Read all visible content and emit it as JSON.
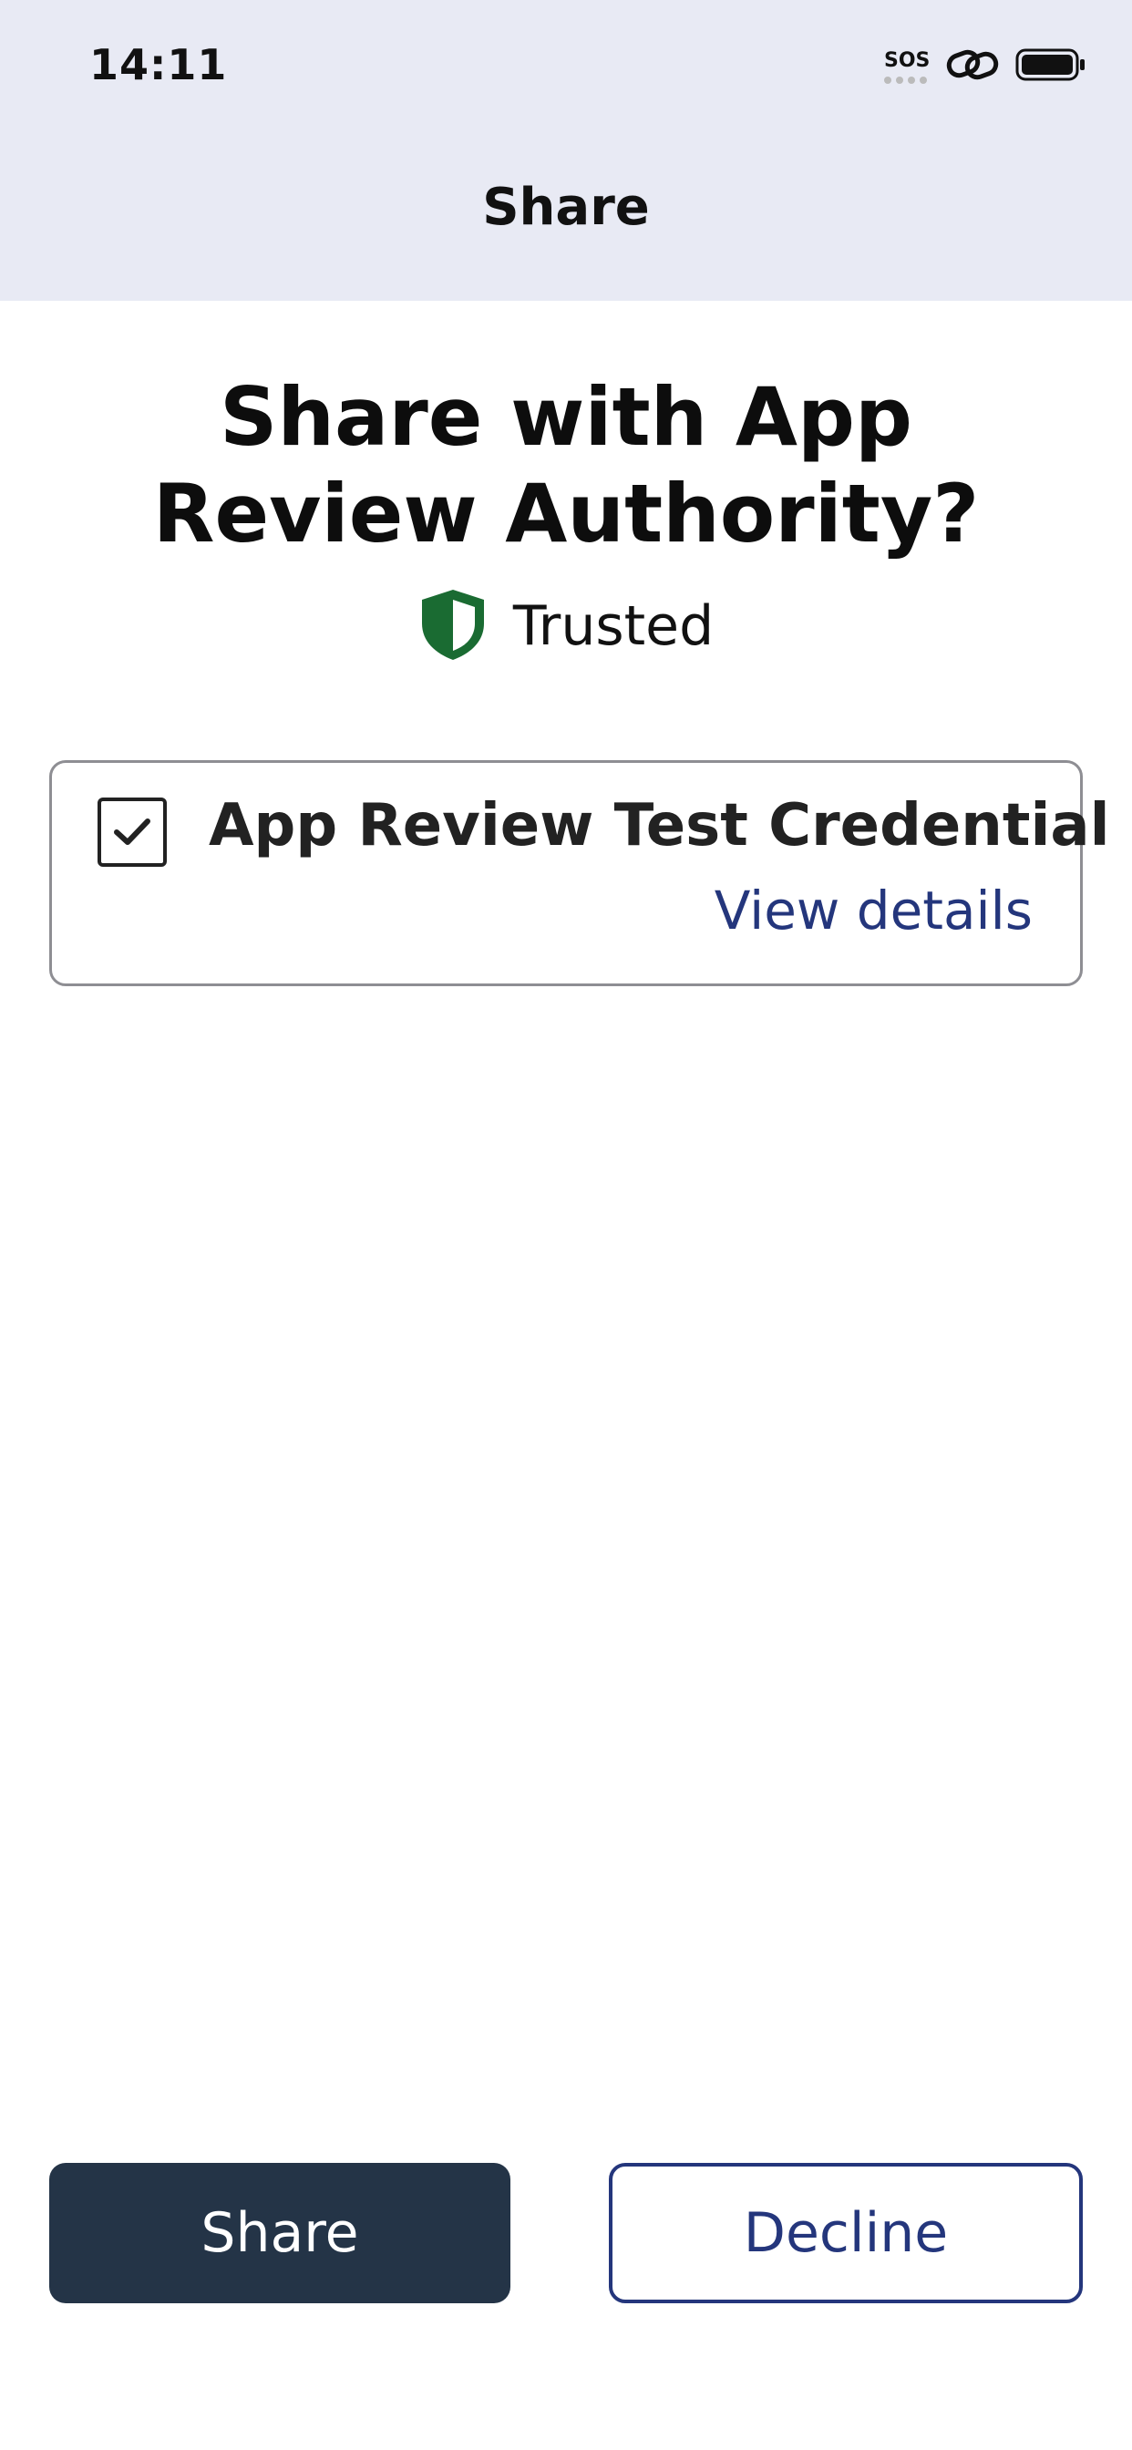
{
  "status_bar": {
    "time": "14:11",
    "sos_label": "SOS",
    "icons": [
      "sos-signal-icon",
      "link-icon",
      "battery-icon"
    ]
  },
  "header": {
    "title": "Share"
  },
  "prompt": {
    "title": "Share with App Review Authority?",
    "trust_label": "Trusted",
    "trust_icon": "shield-icon",
    "trust_color": "#1a6b32"
  },
  "credential": {
    "name": "App Review Test Credential",
    "checked": true,
    "view_details_label": "View details"
  },
  "actions": {
    "share_label": "Share",
    "decline_label": "Decline"
  },
  "colors": {
    "header_bg": "#e8eaf4",
    "primary": "#243447",
    "link": "#24367c",
    "trusted": "#1a6b32"
  }
}
